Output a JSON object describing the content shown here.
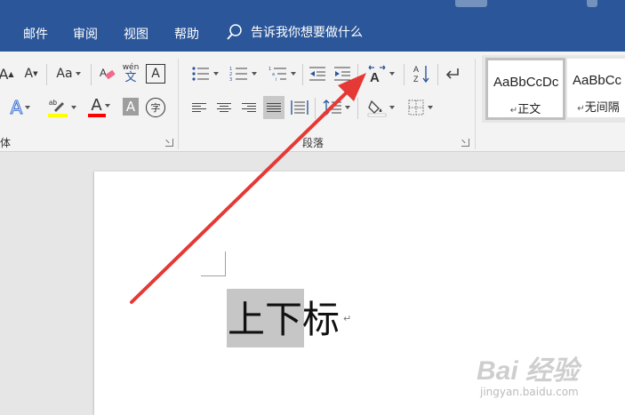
{
  "menu": {
    "tabs": [
      "邮件",
      "审阅",
      "视图",
      "帮助"
    ],
    "tell_me": "告诉我你想要做什么"
  },
  "ribbon": {
    "font_group": {
      "label_fragment": "体",
      "change_case": "Aa",
      "phonetic_top": "wén",
      "phonetic_bottom": "文",
      "char_border": "A",
      "enclose_char": "字",
      "grow": "A",
      "shrink": "A",
      "text_effects": "A",
      "font_color": "A",
      "char_shading": "A",
      "highlight_color": "#ffff00",
      "font_color_bar": "#ff0000"
    },
    "paragraph_group": {
      "label": "段落",
      "sort": "A↓Z"
    },
    "styles_group": {
      "items": [
        {
          "sample": "AaBbCcDc",
          "name": "正文"
        },
        {
          "sample": "AaBbCc",
          "name": "无间隔"
        }
      ],
      "marker": "↵"
    }
  },
  "document": {
    "text": "上下标",
    "selected_chars": 2,
    "para_mark": "↵"
  },
  "watermark": {
    "brand": "Bai 经验",
    "site": "jingyan.baidu.com"
  },
  "colors": {
    "ribbon_blue": "#2b579a",
    "arrow_red": "#e53935"
  }
}
